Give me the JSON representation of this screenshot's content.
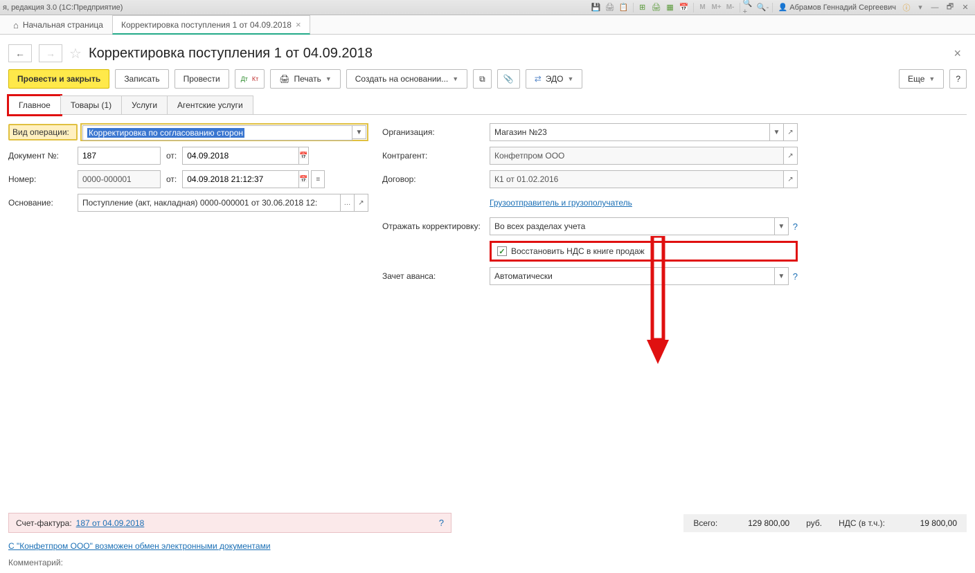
{
  "titlebar": {
    "text": "я, редакция 3.0  (1С:Предприятие)",
    "user": "Абрамов Геннадий Сергеевич",
    "m_icons": [
      "M",
      "M+",
      "M-"
    ]
  },
  "nav": {
    "home": "Начальная страница",
    "active_tab": "Корректировка поступления 1 от 04.09.2018"
  },
  "page": {
    "title": "Корректировка поступления 1 от 04.09.2018"
  },
  "toolbar": {
    "post_close": "Провести и закрыть",
    "write": "Записать",
    "post": "Провести",
    "print": "Печать",
    "create_based": "Создать на основании...",
    "edo": "ЭДО",
    "more": "Еще"
  },
  "tabs": {
    "main": "Главное",
    "goods": "Товары (1)",
    "services": "Услуги",
    "agent": "Агентские услуги"
  },
  "form": {
    "op_type_lbl": "Вид операции:",
    "op_type_val": "Корректировка по согласованию сторон",
    "doc_no_lbl": "Документ №:",
    "doc_no_val": "187",
    "from_lbl": "от:",
    "doc_date": "04.09.2018",
    "num_lbl": "Номер:",
    "num_val": "0000-000001",
    "num_date": "04.09.2018 21:12:37",
    "basis_lbl": "Основание:",
    "basis_val": "Поступление (акт, накладная) 0000-000001 от 30.06.2018 12:",
    "org_lbl": "Организация:",
    "org_val": "Магазин №23",
    "contr_lbl": "Контрагент:",
    "contr_val": "Конфетпром ООО",
    "contract_lbl": "Договор:",
    "contract_val": "К1 от 01.02.2016",
    "shipper_link": "Грузоотправитель и грузополучатель",
    "reflect_lbl": "Отражать корректировку:",
    "reflect_val": "Во всех разделах учета",
    "vat_restore": "Восстановить НДС в книге продаж",
    "advance_lbl": "Зачет аванса:",
    "advance_val": "Автоматически"
  },
  "footer": {
    "sf_lbl": "Счет-фактура:",
    "sf_link": "187 от 04.09.2018",
    "total_lbl": "Всего:",
    "total_val": "129 800,00",
    "currency": "руб.",
    "vat_lbl": "НДС (в т.ч.):",
    "vat_val": "19 800,00",
    "edo_hint": "С \"Конфетпром ООО\" возможен обмен электронными документами",
    "comment_lbl": "Комментарий:"
  }
}
